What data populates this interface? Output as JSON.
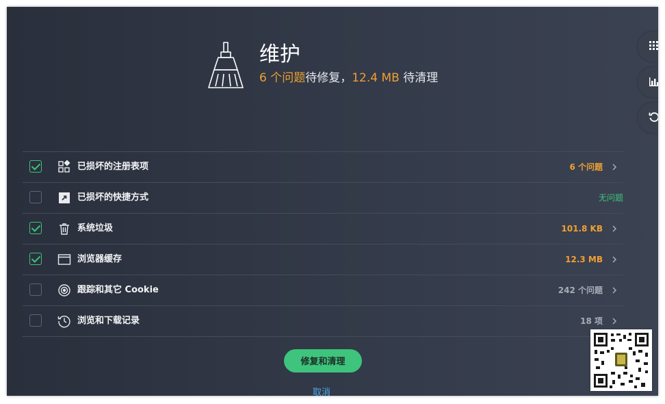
{
  "header": {
    "title": "维护",
    "issue_count": "6 个问题",
    "issue_suffix": "待修复，",
    "size": "12.4 MB",
    "size_suffix": " 待清理"
  },
  "items": [
    {
      "label": "已损坏的注册表项",
      "value": "6 个问题",
      "checked": true,
      "icon": "registry-icon",
      "value_color": "#f0a033"
    },
    {
      "label": "已损坏的快捷方式",
      "value": "无问题",
      "checked": false,
      "icon": "shortcut-icon",
      "value_color": "#3ec47c"
    },
    {
      "label": "系统垃圾",
      "value": "101.8 KB",
      "checked": true,
      "icon": "trash-icon",
      "value_color": "#f0a033"
    },
    {
      "label": "浏览器缓存",
      "value": "12.3 MB",
      "checked": true,
      "icon": "browser-window-icon",
      "value_color": "#f0a033"
    },
    {
      "label": "跟踪和其它 Cookie",
      "value": "242 个问题",
      "checked": false,
      "icon": "target-icon",
      "value_color": "#a7adb8"
    },
    {
      "label": "浏览和下载记录",
      "value": "18 项",
      "checked": false,
      "icon": "history-icon",
      "value_color": "#a7adb8"
    }
  ],
  "actions": {
    "fix_label": "修复和清理",
    "cancel_label": "取消"
  },
  "colors": {
    "accent_green": "#3ec47c",
    "accent_orange": "#f0a033",
    "link_blue": "#4ea8e8"
  }
}
